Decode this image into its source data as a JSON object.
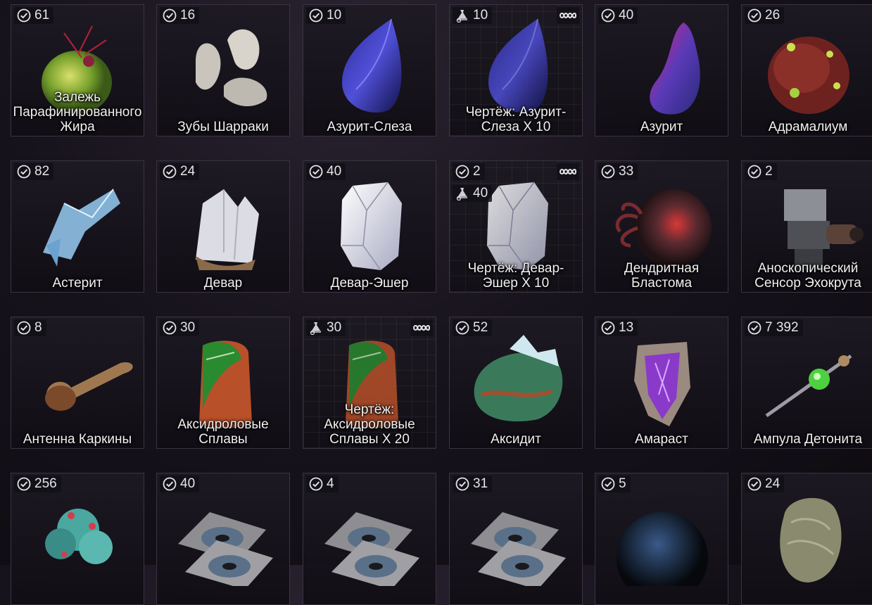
{
  "colors": {
    "text": "#f1f1f1",
    "border": "#3a3440",
    "badge_bg": "#121016"
  },
  "items": [
    {
      "name": "Залежь Парафинированного Жира",
      "qty": "61",
      "blueprint": false,
      "art": "fat-deposit-icon"
    },
    {
      "name": "Зубы Шарраки",
      "qty": "16",
      "blueprint": false,
      "art": "teeth-icon"
    },
    {
      "name": "Азурит-Слеза",
      "qty": "10",
      "blueprint": false,
      "art": "azurite-tear-icon"
    },
    {
      "name": "Чертёж: Азурит-Слеза X 10",
      "qty": "10",
      "blueprint": true,
      "infinite": true,
      "art": "azurite-tear-icon"
    },
    {
      "name": "Азурит",
      "qty": "40",
      "blueprint": false,
      "art": "azurite-icon"
    },
    {
      "name": "Адрамалиум",
      "qty": "26",
      "blueprint": false,
      "art": "adramalium-icon"
    },
    {
      "name": "Астерит",
      "qty": "82",
      "blueprint": false,
      "art": "asterite-icon"
    },
    {
      "name": "Девар",
      "qty": "24",
      "blueprint": false,
      "art": "devar-icon"
    },
    {
      "name": "Девар-Эшер",
      "qty": "40",
      "blueprint": false,
      "art": "devar-esher-icon"
    },
    {
      "name": "Чертёж: Девар-Эшер X 10",
      "qty": "2",
      "blueprint": true,
      "infinite": true,
      "sub_qty": "40",
      "art": "devar-esher-icon"
    },
    {
      "name": "Дендритная Бластома",
      "qty": "33",
      "blueprint": false,
      "art": "blastoma-icon"
    },
    {
      "name": "Аноскопический Сенсор Эхокрута",
      "qty": "2",
      "blueprint": false,
      "art": "sensor-icon"
    },
    {
      "name": "Антенна Каркины",
      "qty": "8",
      "blueprint": false,
      "art": "antenna-icon"
    },
    {
      "name": "Аксидроловые Сплавы",
      "qty": "30",
      "blueprint": false,
      "art": "alloy-icon"
    },
    {
      "name": "Чертёж: Аксидроловые Сплавы X 20",
      "qty": "30",
      "blueprint": true,
      "infinite": true,
      "bp_main": true,
      "art": "alloy-icon"
    },
    {
      "name": "Аксидит",
      "qty": "52",
      "blueprint": false,
      "art": "axidite-icon"
    },
    {
      "name": "Амараст",
      "qty": "13",
      "blueprint": false,
      "art": "amarast-icon"
    },
    {
      "name": "Ампула Детонита",
      "qty": "7 392",
      "blueprint": false,
      "art": "ampule-icon"
    },
    {
      "name": "",
      "qty": "256",
      "blueprint": false,
      "art": "coral-icon"
    },
    {
      "name": "",
      "qty": "40",
      "blueprint": false,
      "art": "disc-icon"
    },
    {
      "name": "",
      "qty": "4",
      "blueprint": false,
      "art": "disc-icon"
    },
    {
      "name": "",
      "qty": "31",
      "blueprint": false,
      "art": "disc-icon"
    },
    {
      "name": "",
      "qty": "5",
      "blueprint": false,
      "art": "sphere-icon"
    },
    {
      "name": "",
      "qty": "24",
      "blueprint": false,
      "art": "rock-icon"
    }
  ]
}
